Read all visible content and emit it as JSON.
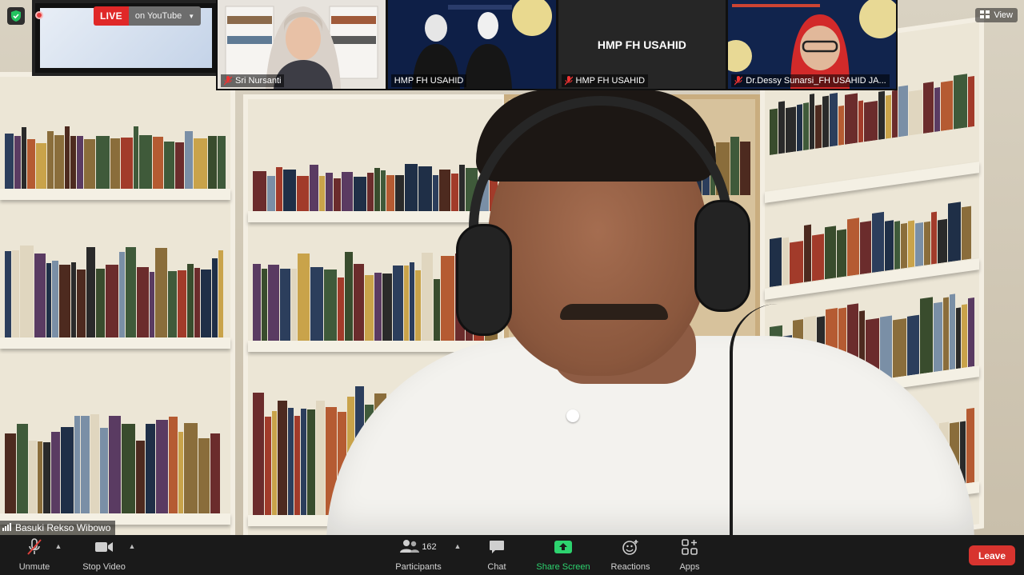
{
  "live": {
    "label": "LIVE",
    "platform": "on YouTube",
    "color": "#e02828"
  },
  "view_button": {
    "label": "View"
  },
  "thumbnails": [
    {
      "name": "Sri Nursanti",
      "muted": true,
      "center_text": ""
    },
    {
      "name": "HMP FH USAHID",
      "muted": false,
      "center_text": ""
    },
    {
      "name": "HMP FH USAHID",
      "muted": true,
      "center_text": "HMP FH USAHID"
    },
    {
      "name": "Dr.Dessy Sunarsi_FH USAHID JA...",
      "muted": true,
      "center_text": ""
    }
  ],
  "speaker": {
    "name": "Basuki Rekso Wibowo"
  },
  "toolbar": {
    "unmute": "Unmute",
    "stop_video": "Stop Video",
    "participants": "Participants",
    "participant_count": "162",
    "chat": "Chat",
    "share_screen": "Share Screen",
    "reactions": "Reactions",
    "apps": "Apps",
    "leave": "Leave",
    "share_color": "#2dd36f",
    "leave_color": "#d8342f"
  },
  "icons": [
    "shield-icon",
    "record-icon",
    "mic-muted-icon",
    "video-camera-icon",
    "participants-icon",
    "chat-icon",
    "share-screen-icon",
    "reactions-icon",
    "apps-icon",
    "view-grid-icon",
    "signal-icon"
  ]
}
